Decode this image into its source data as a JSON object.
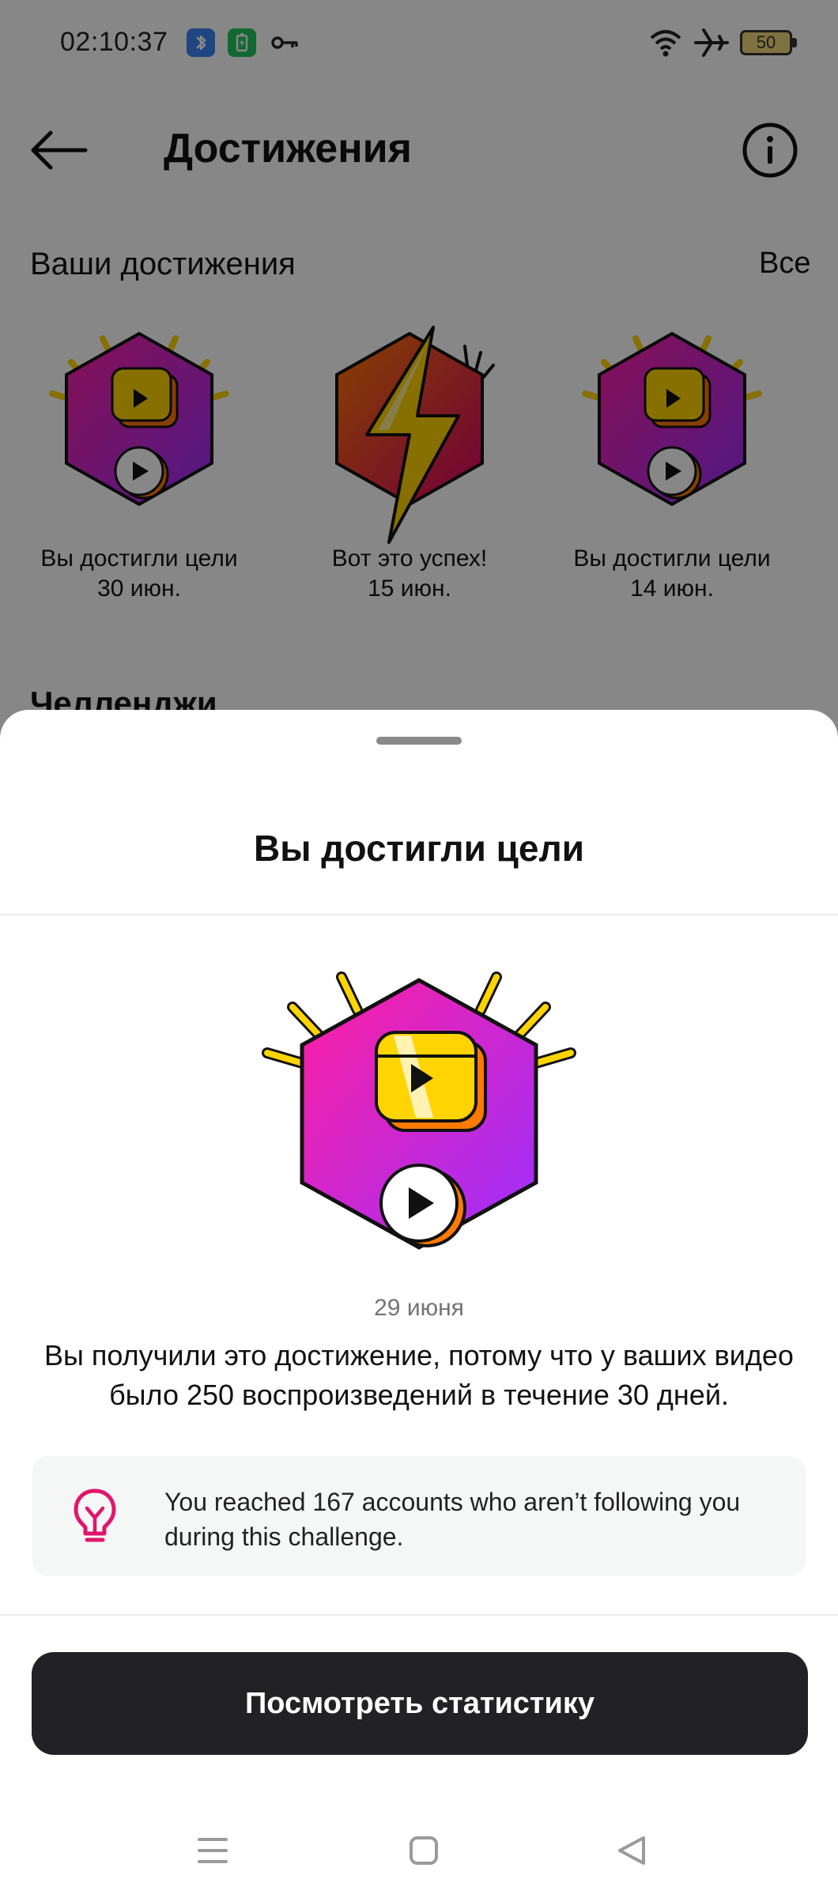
{
  "status_bar": {
    "time": "02:10:37",
    "icons": [
      "bluetooth-icon",
      "battery-saver-icon",
      "key-icon",
      "wifi-icon",
      "airplane-icon"
    ],
    "battery_level": "50"
  },
  "header": {
    "title": "Достижения",
    "back_icon": "arrow-left-icon",
    "info_icon": "info-icon"
  },
  "achievements_section": {
    "title": "Ваши достижения",
    "see_all": "Все",
    "badges": [
      {
        "name": "Вы достигли цели",
        "date": "30 июн.",
        "icon": "reels-goal-badge"
      },
      {
        "name": "Вот это успех!",
        "date": "15 июн.",
        "icon": "lightning-badge"
      },
      {
        "name": "Вы достигли цели",
        "date": "14 июн.",
        "icon": "reels-goal-badge"
      }
    ]
  },
  "challenges_section": {
    "title": "Челленджи"
  },
  "sheet": {
    "title": "Вы достигли цели",
    "date": "29 июня",
    "description": "Вы получили это достижение, потому что у ваших видео было 250 воспроизведений в течение 30 дней.",
    "tip": "You reached 167 accounts who aren’t following you during this challenge.",
    "tip_icon": "lightbulb-icon",
    "button_label": "Посмотреть статистику"
  },
  "nav_bar": {
    "icons": [
      "menu-icon",
      "home-square-icon",
      "back-triangle-icon"
    ]
  },
  "colors": {
    "badge_pink": "#ff1ea0",
    "badge_purple": "#9b30ff",
    "badge_yellow": "#ffd400",
    "badge_orange": "#ff7a00",
    "button_dark": "#222226",
    "tip_pink": "#e0156b"
  }
}
